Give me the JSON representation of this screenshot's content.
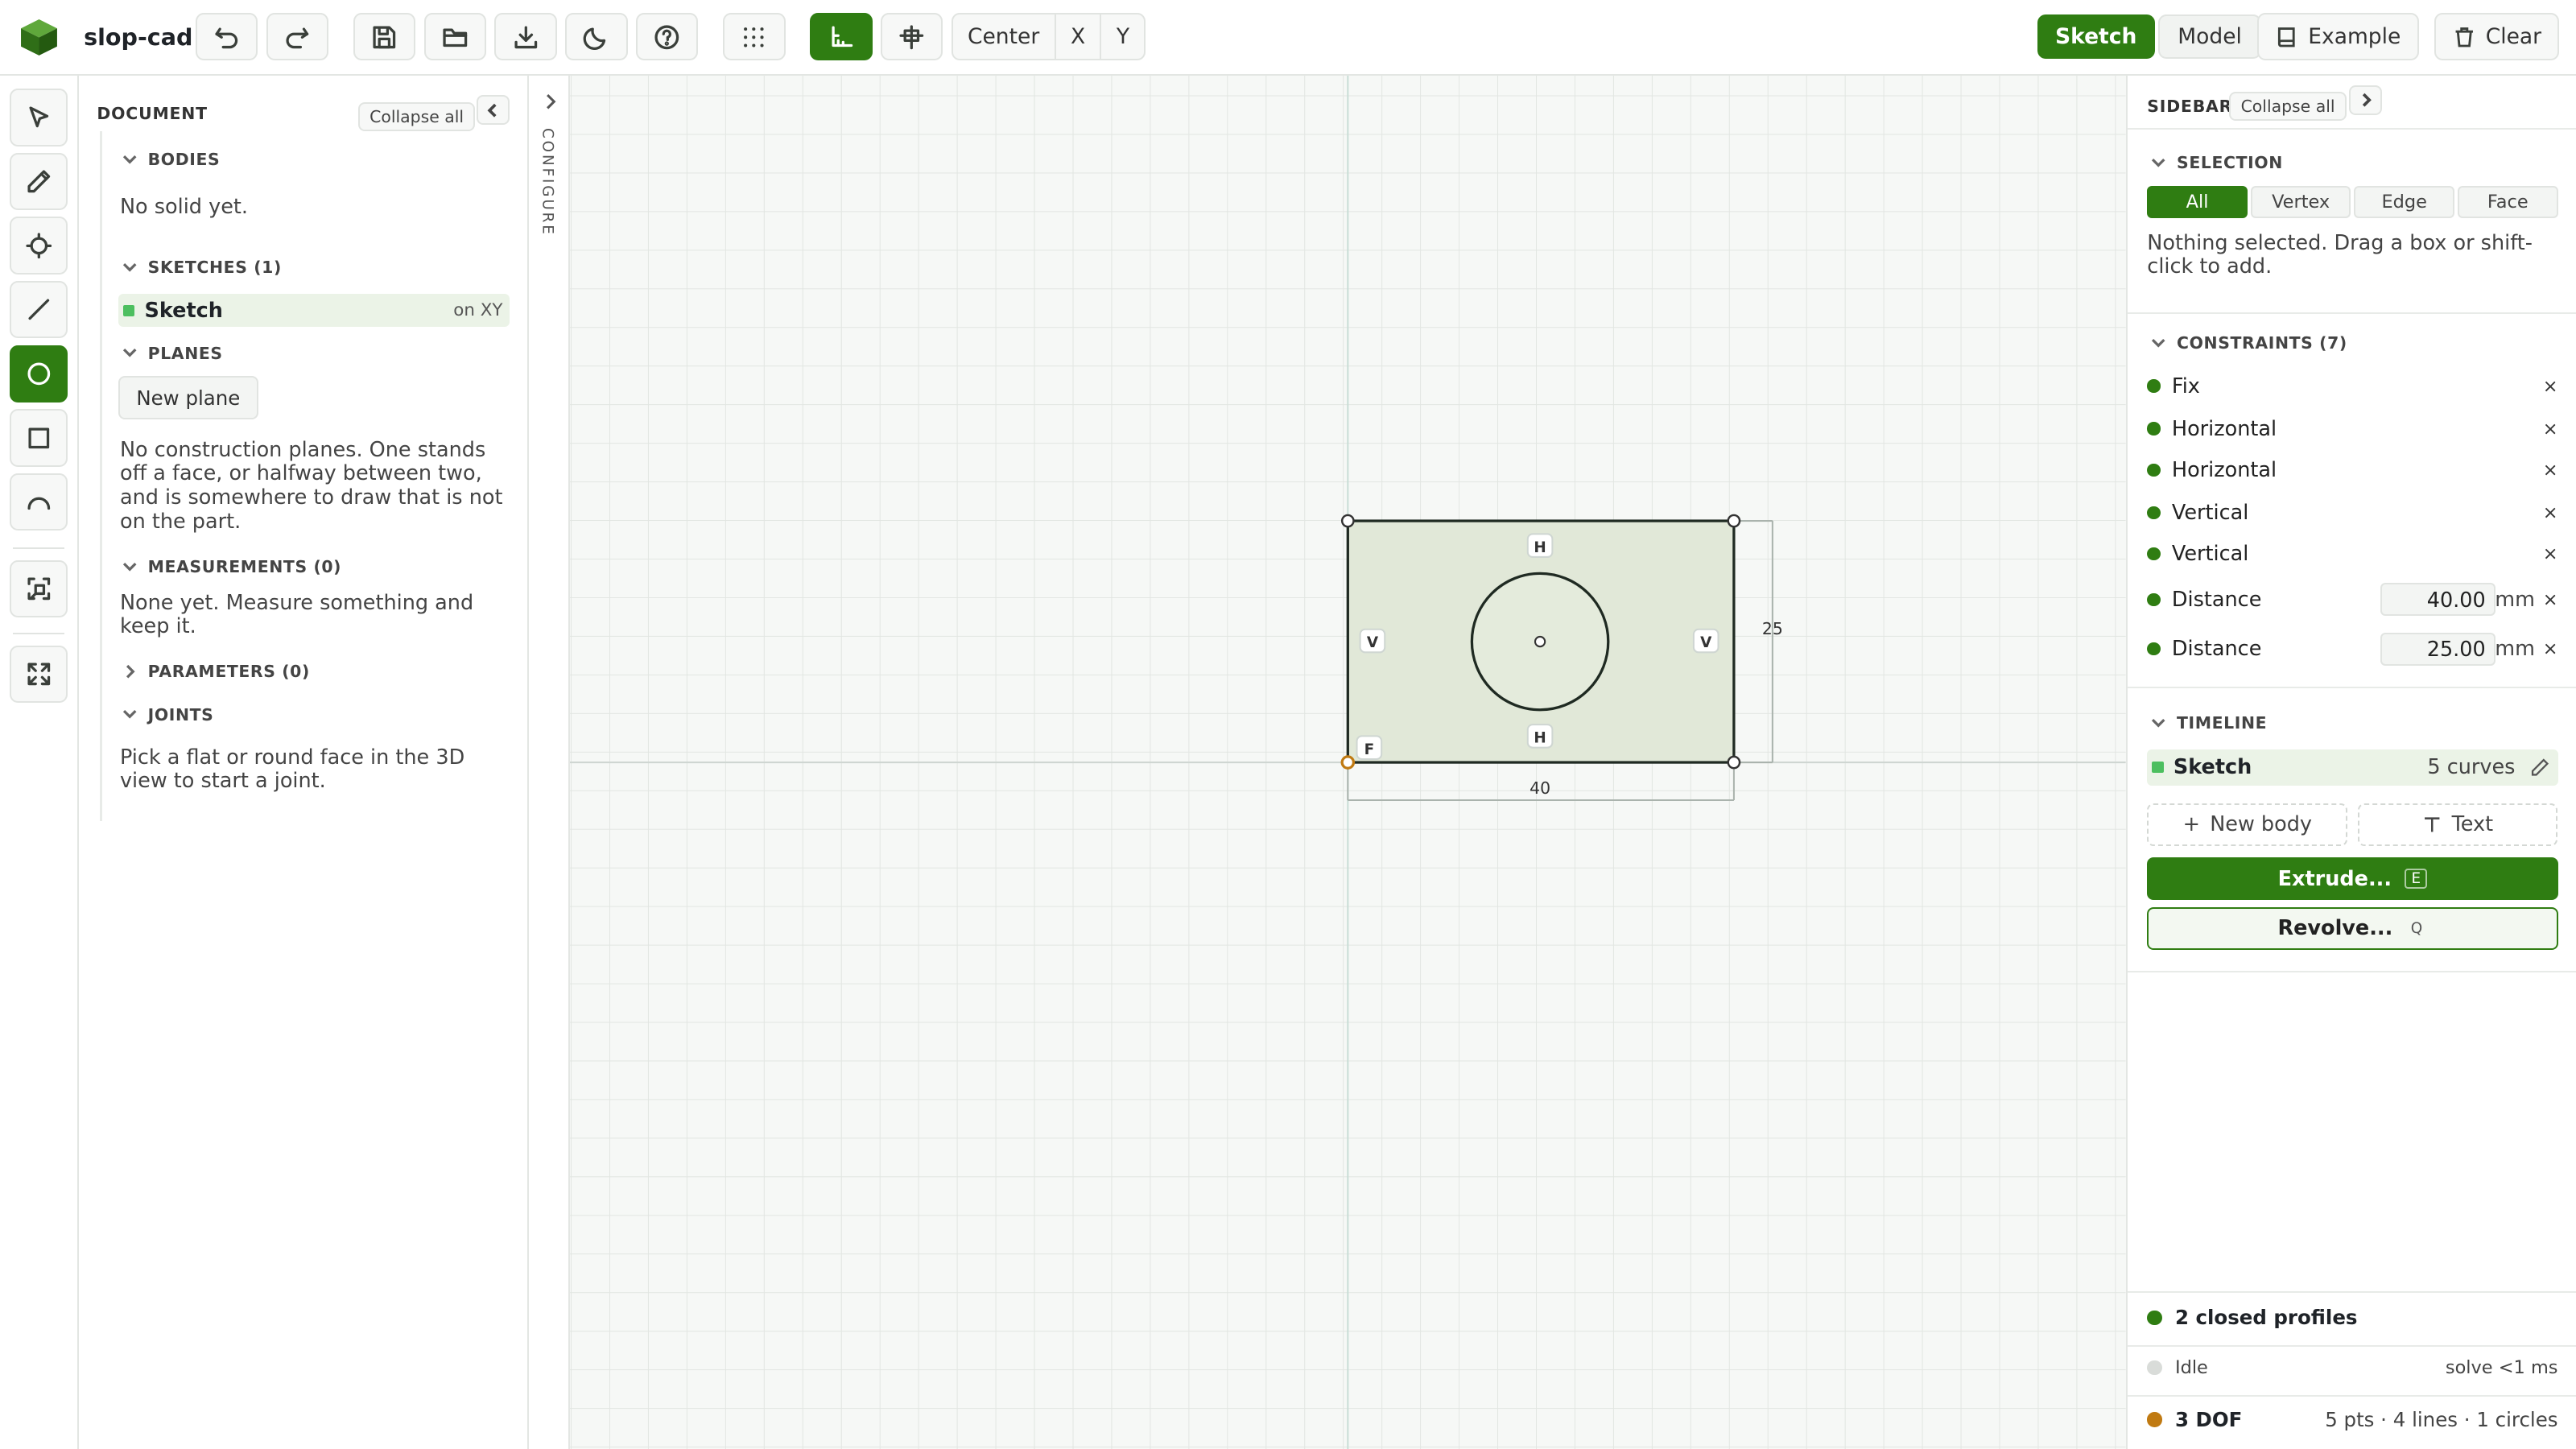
{
  "app": {
    "name": "slop-cad"
  },
  "toolbar": {
    "snap_center": "Center",
    "snap_x": "X",
    "snap_y": "Y",
    "mode_sketch": "Sketch",
    "mode_model": "Model",
    "example_label": "Example",
    "clear_label": "Clear",
    "icons": [
      "undo-icon",
      "redo-icon",
      "save-icon",
      "open-folder-icon",
      "download-icon",
      "dark-mode-icon",
      "help-icon",
      "grid-icon",
      "axes-icon",
      "origin-icon"
    ]
  },
  "tools": {
    "items": [
      "select-tool",
      "pencil-tool",
      "point-tool",
      "line-tool",
      "circle-tool",
      "rectangle-tool",
      "arc-tool",
      "fit-selection-tool",
      "fit-view-tool"
    ],
    "active": "circle-tool"
  },
  "document": {
    "title": "DOCUMENT",
    "collapse_all": "Collapse all",
    "bodies_title": "BODIES",
    "bodies_empty": "No solid yet.",
    "sketches_title": "SKETCHES (1)",
    "sketch_name": "Sketch",
    "sketch_plane": "on XY",
    "planes_title": "PLANES",
    "new_plane": "New plane",
    "planes_empty": "No construction planes. One stands off a face, or halfway between two, and is somewhere to draw that is not on the part.",
    "measurements_title": "MEASUREMENTS (0)",
    "measurements_empty": "None yet. Measure something and keep it.",
    "parameters_title": "PARAMETERS (0)",
    "joints_title": "JOINTS",
    "joints_empty": "Pick a flat or round face in the 3D view to start a joint."
  },
  "configure": {
    "label": "CONFIGURE"
  },
  "canvas": {
    "dim_width": "40",
    "dim_height": "25",
    "labels": {
      "top": "H",
      "bottom": "H",
      "left": "V",
      "right": "V",
      "fix": "F"
    }
  },
  "sidebar": {
    "title": "SIDEBAR",
    "collapse_all": "Collapse all",
    "selection_title": "SELECTION",
    "selection_filters": [
      "All",
      "Vertex",
      "Edge",
      "Face"
    ],
    "selection_active": "All",
    "selection_hint": "Nothing selected. Drag a box or shift-click to add.",
    "constraints_title": "CONSTRAINTS (7)",
    "constraints": [
      {
        "name": "Fix"
      },
      {
        "name": "Horizontal"
      },
      {
        "name": "Horizontal"
      },
      {
        "name": "Vertical"
      },
      {
        "name": "Vertical"
      },
      {
        "name": "Distance",
        "value": "40.00",
        "unit": "mm"
      },
      {
        "name": "Distance",
        "value": "25.00",
        "unit": "mm"
      }
    ],
    "remove_glyph": "×",
    "timeline_title": "TIMELINE",
    "timeline_item": "Sketch",
    "timeline_meta": "5 curves",
    "new_body": "New body",
    "text_btn": "Text",
    "extrude": "Extrude...",
    "extrude_key": "E",
    "revolve": "Revolve...",
    "revolve_key": "Q"
  },
  "status": {
    "profiles": "2 closed profiles",
    "state": "Idle",
    "solve": "solve <1 ms",
    "dof": "3 DOF",
    "counts": "5 pts · 4 lines · 1 circles",
    "colors": {
      "ok": "#2f7d12",
      "idle": "#d9dcd9",
      "warn": "#c07a12"
    }
  },
  "theme": {
    "accent": "#2f7d12",
    "sketch_fill": "#e2e8d8",
    "grid": "#e3e7e3"
  }
}
